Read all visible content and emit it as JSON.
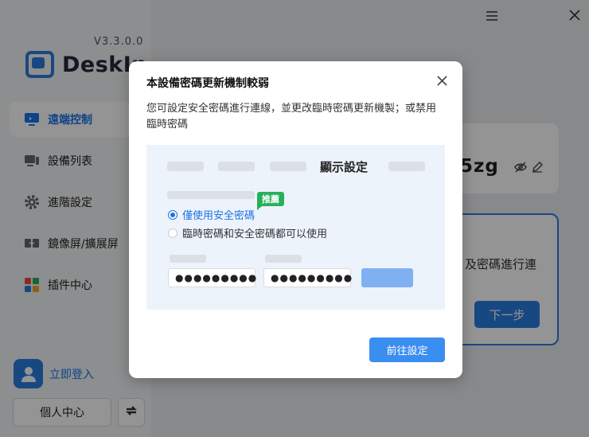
{
  "app": {
    "version": "V3.3.0.0",
    "brand_name": "DeskIn",
    "nav": [
      {
        "label": "遠端控制",
        "icon": "monitor-icon",
        "active": true
      },
      {
        "label": "設備列表",
        "icon": "devices-icon",
        "active": false
      },
      {
        "label": "進階設定",
        "icon": "gear-icon",
        "active": false
      },
      {
        "label": "鏡像屏/擴展屏",
        "icon": "mirror-screen-icon",
        "active": false
      },
      {
        "label": "插件中心",
        "icon": "plugin-icon",
        "active": false
      }
    ],
    "login_label": "立即登入",
    "personal_center_label": "個人中心",
    "card1_code": "5zg",
    "card2_text": "及密碼進行連",
    "card2_next_label": "下一步"
  },
  "modal": {
    "title": "本設備密碼更新機制較弱",
    "description": "您可設定安全密碼進行連線，並更改臨時密碼更新機製；或禁用臨時密碼",
    "preview": {
      "title": "顯示設定",
      "badge": "推薦",
      "option1": "僅使用安全密碼",
      "option2": "臨時密碼和安全密碼都可以使用",
      "password1": "●●●●●●●●●",
      "password2": "●●●●●●●●●"
    },
    "goto_button": "前往設定"
  },
  "colors": {
    "accent": "#2a7de1",
    "badge": "#27b05a",
    "button": "#3a8ef0"
  }
}
